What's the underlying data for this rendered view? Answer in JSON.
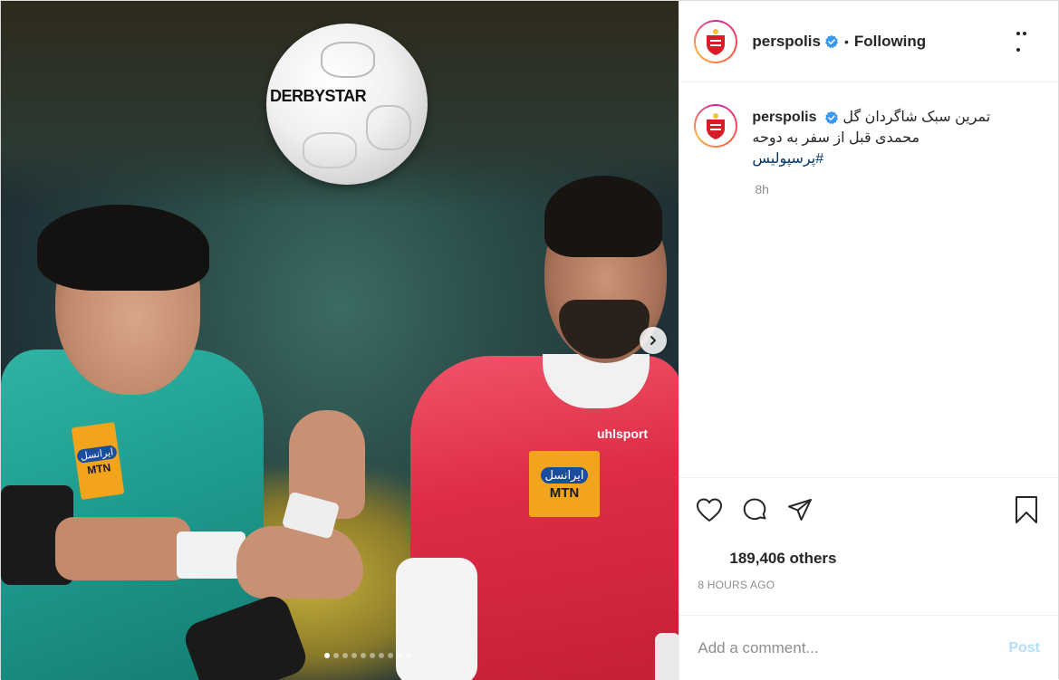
{
  "account": {
    "username": "perspolis",
    "separator": "•",
    "follow_status": "Following"
  },
  "caption": {
    "username": "perspolis",
    "text_line1": "تمرین سبک شاگردان گل",
    "text_line2": "محمدی قبل از سفر به دوحه",
    "hashtag": "#پرسپولیس",
    "time": "8h"
  },
  "photo": {
    "ball_brand": "DERBYSTAR",
    "sponsor_top": "ایرانسل",
    "sponsor_bottom": "MTN",
    "kit_brand": "uhlsport",
    "carousel_slides": 10,
    "carousel_active_index": 0
  },
  "engagement": {
    "likes_text": "189,406 others",
    "posted_ago": "8 HOURS AGO"
  },
  "comment_box": {
    "placeholder": "Add a comment...",
    "post_label": "Post"
  },
  "colors": {
    "verified": "#3897f0",
    "hashtag": "#00376b",
    "post_button": "#b2dffc",
    "muted": "#8e8e8e",
    "club_red": "#d71e28"
  },
  "icons": {
    "like": "heart-icon",
    "comment": "comment-bubble-icon",
    "share": "paper-plane-icon",
    "save": "bookmark-icon",
    "more": "more-options-icon",
    "next": "chevron-right-icon",
    "verified": "verified-badge-icon"
  }
}
